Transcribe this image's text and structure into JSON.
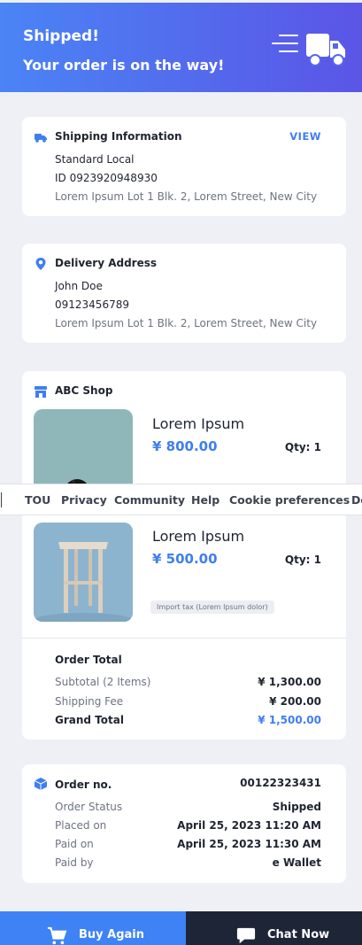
{
  "header": {
    "title": "Shipped!",
    "subtitle": "Your order is on the way!",
    "icons": [
      "menu-lines-icon",
      "truck-icon"
    ]
  },
  "shipping": {
    "title": "Shipping Information",
    "view_label": "VIEW",
    "method": "Standard Local",
    "tracking_id": "ID 0923920948930",
    "address": "Lorem Ipsum Lot 1 Blk. 2, Lorem Street, New City",
    "icon": "truck-icon"
  },
  "delivery": {
    "title": "Delivery Address",
    "name": "John Doe",
    "phone": "09123456789",
    "address": "Lorem Ipsum Lot 1 Blk. 2, Lorem Street, New City",
    "icon": "location-pin-icon"
  },
  "shop": {
    "title": "ABC Shop",
    "icon": "store-icon",
    "products": [
      {
        "name": "Lorem Ipsum",
        "price": "¥ 800.00",
        "qty": "Qty: 1",
        "image": "black-chair"
      },
      {
        "name": "Lorem Ipsum",
        "price": "¥ 500.00",
        "qty": "Qty: 1",
        "image": "wooden-stool",
        "tax_note": "Import tax (Lorem Ipsum dolor)"
      }
    ],
    "order_total": {
      "title": "Order Total",
      "rows": [
        {
          "label": "Subtotal (2 Items)",
          "value": "¥ 1,300.00"
        },
        {
          "label": "Shipping Fee",
          "value": "¥ 200.00"
        },
        {
          "label": "Grand Total",
          "value": "¥ 1,500.00"
        }
      ]
    }
  },
  "order": {
    "title": "Order no.",
    "number": "00122323431",
    "icon": "box-icon",
    "rows": [
      {
        "label": "Order Status",
        "value": "Shipped"
      },
      {
        "label": "Placed on",
        "value": "April 25, 2023  11:20 AM"
      },
      {
        "label": "Paid on",
        "value": "April 25, 2023  11:30 AM"
      },
      {
        "label": "Paid by",
        "value": "e Wallet"
      }
    ]
  },
  "overlay_nav": {
    "links": [
      "TOU",
      "Privacy",
      "Community",
      "Help",
      "Cookie preferences",
      "Do"
    ]
  },
  "actions": {
    "buy_again": "Buy Again",
    "chat_now": "Chat Now"
  },
  "colors": {
    "accent": "#3f7ef0",
    "header_start": "#4a84f5",
    "header_end": "#5b55e6",
    "dark_button": "#1e2537",
    "background": "#eef0f5"
  }
}
